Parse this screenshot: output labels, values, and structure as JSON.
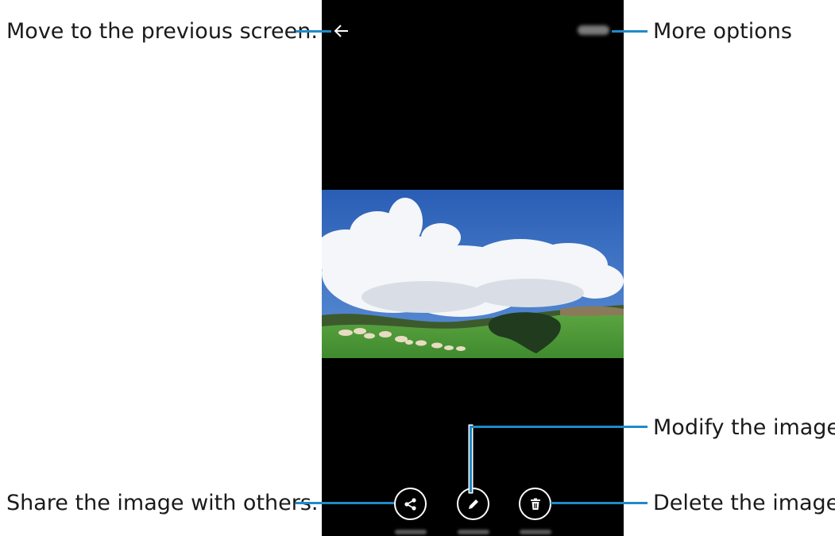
{
  "annotations": {
    "back": "Move to the previous screen.",
    "more": "More options",
    "modify": "Modify the image.",
    "share": "Share the image with others.",
    "delete": "Delete the image."
  },
  "toolbar": {
    "back_icon": "arrow-left-icon",
    "more_icon": "more-options-icon"
  },
  "bottom_bar": {
    "share_icon": "share-icon",
    "edit_icon": "pencil-icon",
    "delete_icon": "trash-icon"
  },
  "colors": {
    "leader": "#1f8ac6",
    "screen_bg": "#000000",
    "sky": "#2f62b8",
    "grass": "#4f9a3a"
  }
}
